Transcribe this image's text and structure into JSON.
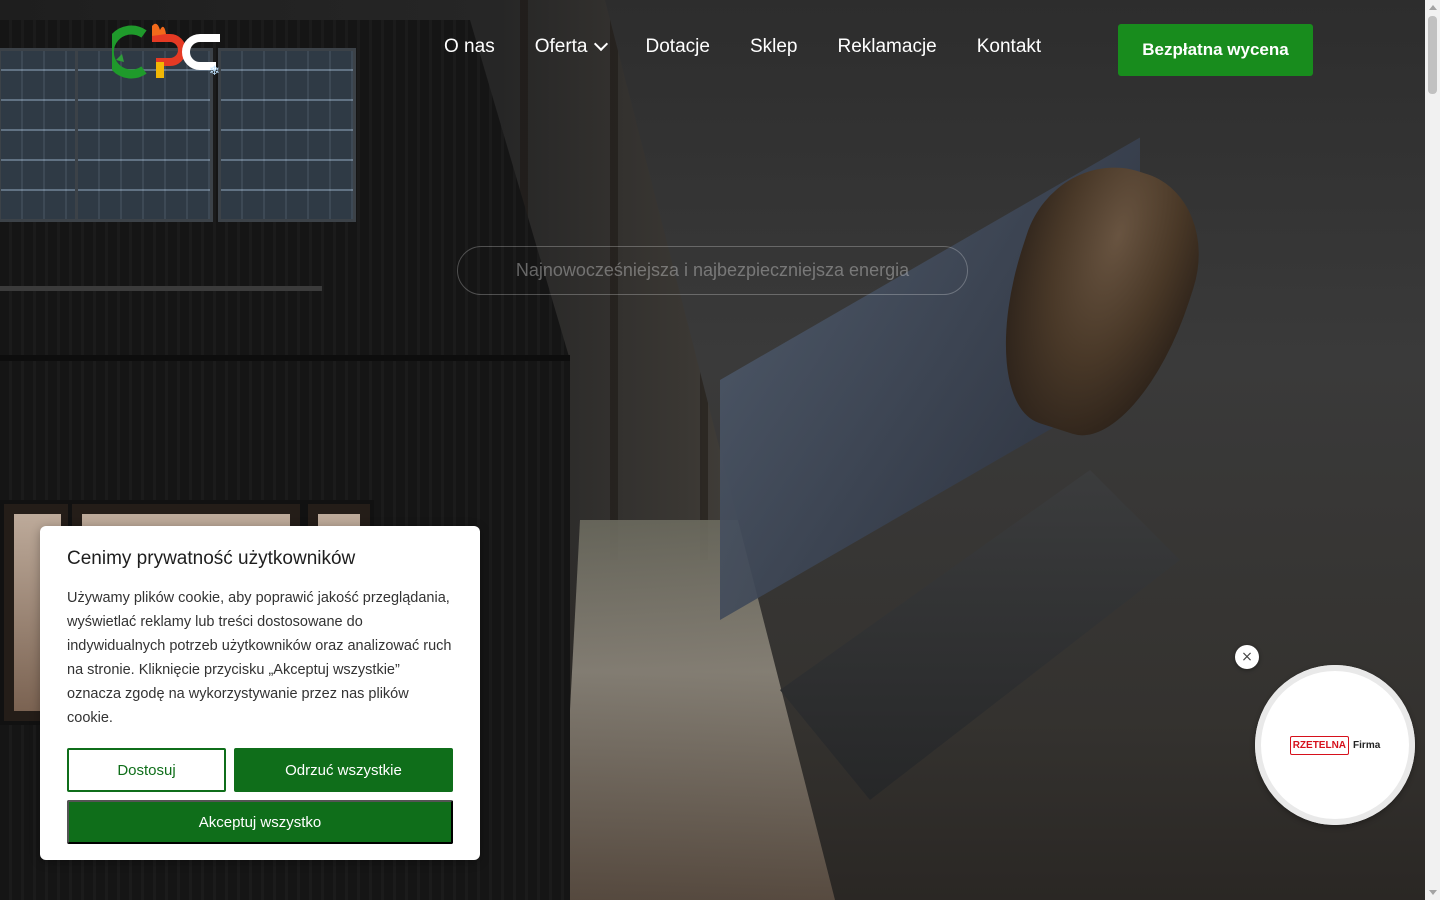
{
  "header": {
    "logo_alt": "logo",
    "nav": [
      {
        "label": "O nas"
      },
      {
        "label": "Oferta",
        "has_dropdown": true
      },
      {
        "label": "Dotacje"
      },
      {
        "label": "Sklep"
      },
      {
        "label": "Reklamacje"
      },
      {
        "label": "Kontakt"
      }
    ],
    "cta_label": "Bezpłatna wycena"
  },
  "hero": {
    "tagline": "Najnowocześniejsza i najbezpieczniejsza energia"
  },
  "cookie": {
    "title": "Cenimy prywatność użytkowników",
    "body": "Używamy plików cookie, aby poprawić jakość przeglądania, wyświetlać reklamy lub treści dostosowane do indywidualnych potrzeb użytkowników oraz analizować ruch na stronie. Kliknięcie przycisku „Akceptuj wszystkie” oznacza zgodę na wykorzystywanie przez nas plików cookie.",
    "customize_label": "Dostosuj",
    "reject_label": "Odrzuć wszystkie",
    "accept_label": "Akceptuj wszystko"
  },
  "badge": {
    "brand_red": "RZETELNA",
    "brand_dark": "Firma",
    "close_symbol": "×"
  },
  "colors": {
    "primary_green": "#188c1d",
    "cookie_green": "#0f6e1a"
  },
  "icons": {
    "dropdown": "chevron-down-icon",
    "close": "close-icon"
  }
}
